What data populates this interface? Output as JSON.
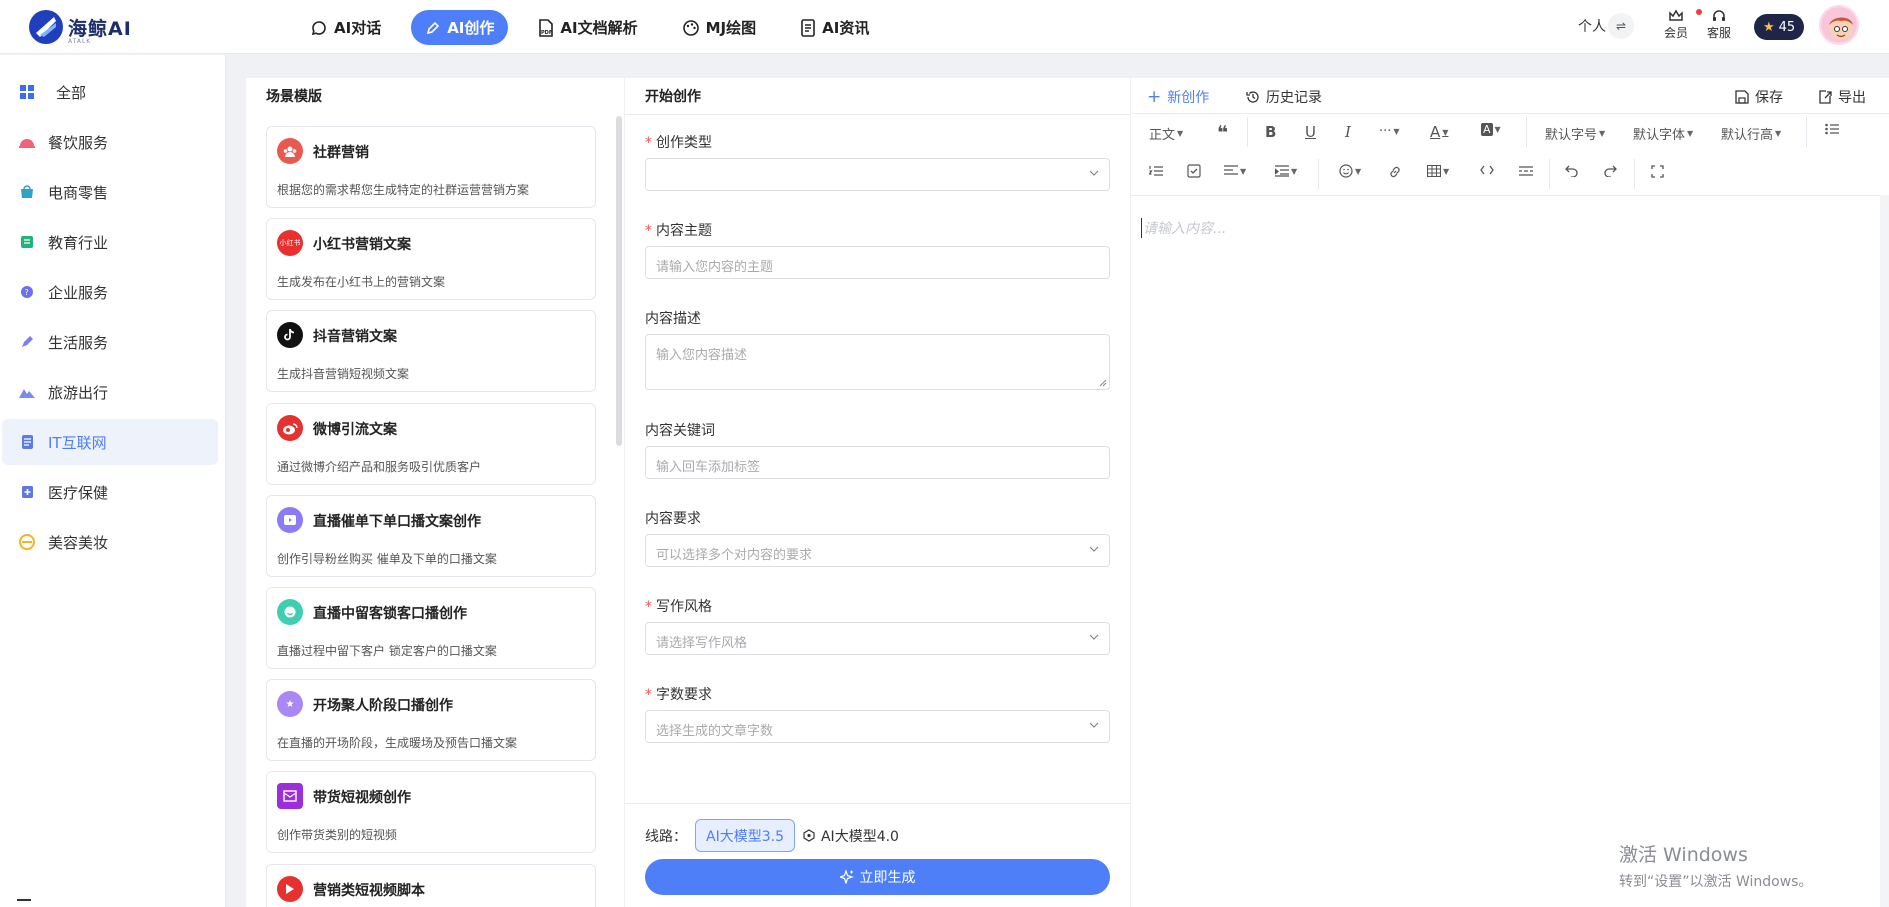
{
  "app": {
    "logo_text": "海鲸AI",
    "logo_sub": "ATALK"
  },
  "nav": [
    {
      "label": "AI对话",
      "icon": "chat-icon"
    },
    {
      "label": "AI创作",
      "icon": "pen-icon",
      "active": true
    },
    {
      "label": "AI文档解析",
      "icon": "pdf-icon"
    },
    {
      "label": "MJ绘图",
      "icon": "palette-icon"
    },
    {
      "label": "AI资讯",
      "icon": "news-icon"
    }
  ],
  "header": {
    "personal": "个人",
    "vip": "会员",
    "service": "客服",
    "credits": "45"
  },
  "sidebar": {
    "items": [
      {
        "label": "全部",
        "icon": "grid-icon"
      },
      {
        "label": "餐饮服务",
        "icon": "dining-icon"
      },
      {
        "label": "电商零售",
        "icon": "shop-icon"
      },
      {
        "label": "教育行业",
        "icon": "education-icon"
      },
      {
        "label": "企业服务",
        "icon": "enterprise-icon"
      },
      {
        "label": "生活服务",
        "icon": "life-icon"
      },
      {
        "label": "旅游出行",
        "icon": "travel-icon"
      },
      {
        "label": "IT互联网",
        "icon": "it-icon",
        "active": true
      },
      {
        "label": "医疗保健",
        "icon": "medical-icon"
      },
      {
        "label": "美容美妆",
        "icon": "beauty-icon"
      }
    ]
  },
  "templates": {
    "title": "场景模版",
    "items": [
      {
        "name": "社群营销",
        "desc": "根据您的需求帮您生成特定的社群运营营销方案",
        "color": "#e85a4f",
        "icon": "community-icon"
      },
      {
        "name": "小红书营销文案",
        "desc": "生成发布在小红书上的营销文案",
        "color": "#e8312f",
        "icon": "xiaohongshu-icon",
        "badge": "小红书"
      },
      {
        "name": "抖音营销文案",
        "desc": "生成抖音营销短视频文案",
        "color": "#111111",
        "icon": "douyin-icon"
      },
      {
        "name": "微博引流文案",
        "desc": "通过微博介绍产品和服务吸引优质客户",
        "color": "#e6322f",
        "icon": "weibo-icon"
      },
      {
        "name": "直播催单下单口播文案创作",
        "desc": "创作引导粉丝购买 催单及下单的口播文案",
        "color": "#8b7cf6",
        "icon": "live-icon"
      },
      {
        "name": "直播中留客锁客口播创作",
        "desc": "直播过程中留下客户 锁定客户的口播文案",
        "color": "#3ecfb2",
        "icon": "retain-icon"
      },
      {
        "name": "开场聚人阶段口播创作",
        "desc": "在直播的开场阶段，生成暖场及预告口播文案",
        "color": "#a888f5",
        "icon": "star-icon"
      },
      {
        "name": "带货短视频创作",
        "desc": "创作带货类别的短视频",
        "color": "#9b2fd9",
        "icon": "video-icon"
      },
      {
        "name": "营销类短视频脚本",
        "desc": "",
        "color": "#e6322f",
        "icon": "play-icon"
      }
    ]
  },
  "form": {
    "title": "开始创作",
    "type_label": "创作类型",
    "topic_label": "内容主题",
    "topic_placeholder": "请输入您内容的主题",
    "desc_label": "内容描述",
    "desc_placeholder": "输入您内容描述",
    "keyword_label": "内容关键词",
    "keyword_placeholder": "输入回车添加标签",
    "req_label": "内容要求",
    "req_placeholder": "可以选择多个对内容的要求",
    "style_label": "写作风格",
    "style_placeholder": "请选择写作风格",
    "count_label": "字数要求",
    "count_placeholder": "选择生成的文章字数",
    "route_label": "线路：",
    "model_a": "AI大模型3.5",
    "model_b": "AI大模型4.0",
    "generate": "立即生成"
  },
  "editor": {
    "new": "新创作",
    "history": "历史记录",
    "save": "保存",
    "export": "导出",
    "paragraph": "正文",
    "font_size": "默认字号",
    "font_family": "默认字体",
    "line_height": "默认行高",
    "placeholder": "请输入内容..."
  },
  "watermark": {
    "line1": "激活 Windows",
    "line2": "转到“设置”以激活 Windows。"
  },
  "colors": {
    "accent": "#4e7ff8",
    "required": "#f05454"
  }
}
